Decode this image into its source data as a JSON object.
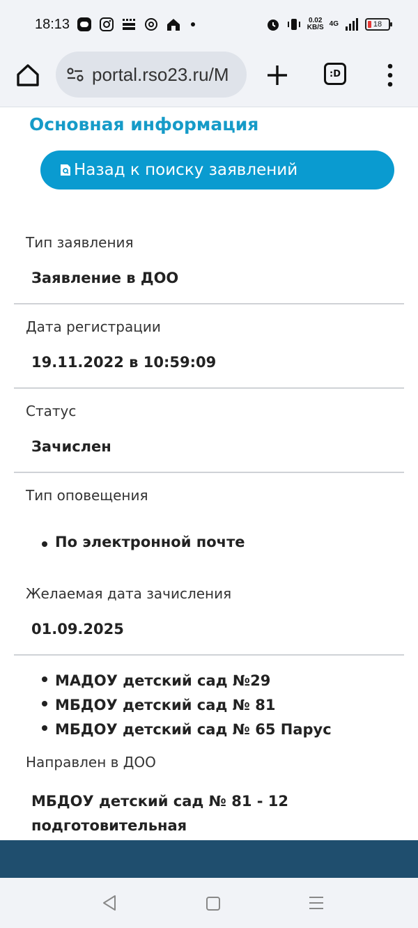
{
  "status_bar": {
    "time": "18:13",
    "net_speed_value": "0.02",
    "net_speed_unit": "KB/S",
    "network": "4G",
    "battery": "18"
  },
  "browser": {
    "url": "portal.rso23.ru/M",
    "tabs_label": ":D"
  },
  "page": {
    "section_title": "Основная информация",
    "back_button_label": "Назад к поиску заявлений",
    "fields": {
      "app_type": {
        "label": "Тип заявления",
        "value": "Заявление в ДОО"
      },
      "reg_date": {
        "label": "Дата регистрации",
        "value": "19.11.2022 в 10:59:09"
      },
      "status": {
        "label": "Статус",
        "value": "Зачислен"
      },
      "notify_type": {
        "label": "Тип оповещения",
        "items": [
          "По электронной почте"
        ]
      },
      "desired_date": {
        "label": "Желаемая дата зачисления",
        "value": "01.09.2025"
      },
      "kindergartens": {
        "items": [
          "МАДОУ детский сад №29",
          "МБДОУ детский сад № 81",
          "МБДОУ детский сад № 65 Парус"
        ]
      },
      "sent_to": {
        "label": "Направлен в ДОО",
        "value_line1": "МБДОУ детский сад № 81 - 12",
        "value_line2": "подготовительная"
      }
    }
  },
  "icons": {
    "home": "home-icon",
    "tune": "site-settings-icon",
    "plus": "new-tab-icon",
    "more": "more-vert-icon",
    "doc": "document-search-icon",
    "nav_back": "nav-back-icon",
    "nav_home": "nav-home-icon",
    "nav_menu": "nav-menu-icon"
  },
  "colors": {
    "accent": "#0a9bd0",
    "title": "#169bc8",
    "footer": "#1f4e6e"
  }
}
